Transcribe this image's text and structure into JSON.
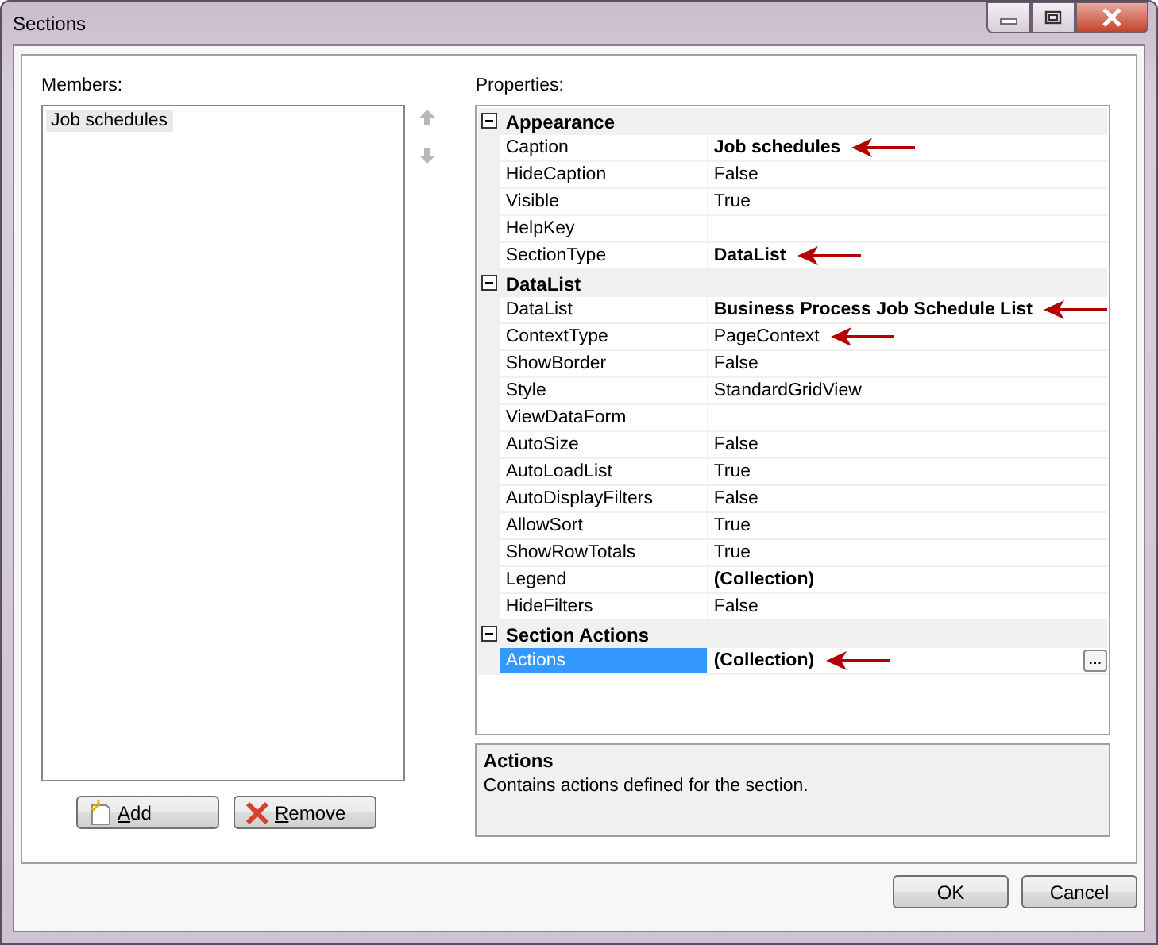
{
  "window": {
    "title": "Sections"
  },
  "members": {
    "label": "Members:",
    "items": [
      {
        "text": "Job schedules",
        "selected": true
      }
    ],
    "buttons": [
      {
        "label": "Add",
        "kind": "add"
      },
      {
        "label": "Remove",
        "kind": "remove"
      }
    ]
  },
  "properties": {
    "label": "Properties:",
    "categories": [
      {
        "name": "Appearance",
        "expanded": true,
        "rows": [
          {
            "name": "Caption",
            "value": "Job schedules",
            "bold": true,
            "arrow": true,
            "selected": false
          },
          {
            "name": "HideCaption",
            "value": "False",
            "bold": false,
            "arrow": false,
            "selected": false
          },
          {
            "name": "Visible",
            "value": "True",
            "bold": false,
            "arrow": false,
            "selected": false
          },
          {
            "name": "HelpKey",
            "arrow": false,
            "selected": false
          },
          {
            "name": "SectionType",
            "value": "DataList",
            "bold": true,
            "arrow": true,
            "selected": false
          }
        ]
      },
      {
        "name": "DataList",
        "expanded": true,
        "rows": [
          {
            "name": "DataList",
            "value": "Business Process Job Schedule List",
            "bold": true,
            "arrow": true,
            "selected": false
          },
          {
            "name": "ContextType",
            "value": "PageContext",
            "bold": false,
            "arrow": true,
            "selected": false
          },
          {
            "name": "ShowBorder",
            "value": "False",
            "bold": false,
            "arrow": false,
            "selected": false
          },
          {
            "name": "Style",
            "value": "StandardGridView",
            "bold": false,
            "arrow": false,
            "selected": false
          },
          {
            "name": "ViewDataForm",
            "arrow": false,
            "selected": false
          },
          {
            "name": "AutoSize",
            "value": "False",
            "bold": false,
            "arrow": false,
            "selected": false
          },
          {
            "name": "AutoLoadList",
            "value": "True",
            "bold": false,
            "arrow": false,
            "selected": false
          },
          {
            "name": "AutoDisplayFilters",
            "value": "False",
            "bold": false,
            "arrow": false,
            "selected": false
          },
          {
            "name": "AllowSort",
            "value": "True",
            "bold": false,
            "arrow": false,
            "selected": false
          },
          {
            "name": "ShowRowTotals",
            "value": "True",
            "bold": false,
            "arrow": false,
            "selected": false
          },
          {
            "name": "Legend",
            "value": "(Collection)",
            "bold": true,
            "arrow": false,
            "selected": false
          },
          {
            "name": "HideFilters",
            "value": "False",
            "bold": false,
            "arrow": false,
            "selected": false
          }
        ]
      },
      {
        "name": "Section Actions",
        "expanded": true,
        "rows": [
          {
            "name": "Actions",
            "value": "(Collection)",
            "bold": true,
            "arrow": true,
            "selected": true,
            "ellipsis": "..."
          }
        ]
      }
    ],
    "description": {
      "title": "Actions",
      "text": "Contains actions defined for the section."
    }
  },
  "buttons": [
    "OK",
    "Cancel"
  ]
}
